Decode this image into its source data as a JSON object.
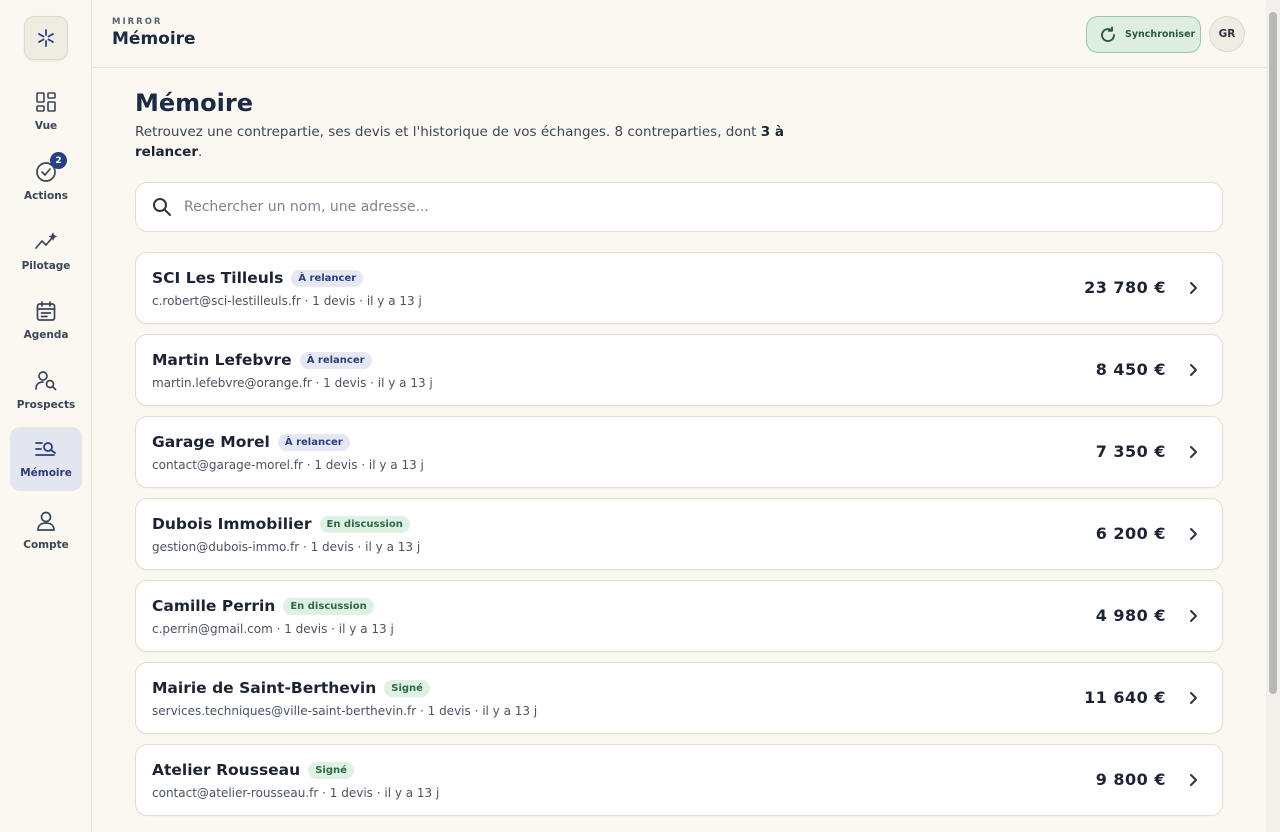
{
  "app": {
    "brand": "MIRROR",
    "title": "Mémoire"
  },
  "header": {
    "sync_label": "Synchroniser",
    "avatar_initials": "GR"
  },
  "sidebar": {
    "items": [
      {
        "label": "Vue",
        "icon": "dashboard-icon"
      },
      {
        "label": "Actions",
        "icon": "check-circle-icon",
        "badge": "2"
      },
      {
        "label": "Pilotage",
        "icon": "trend-sparkle-icon"
      },
      {
        "label": "Agenda",
        "icon": "calendar-icon"
      },
      {
        "label": "Prospects",
        "icon": "user-search-icon"
      },
      {
        "label": "Mémoire",
        "icon": "list-search-icon",
        "active": true
      },
      {
        "label": "Compte",
        "icon": "user-icon"
      }
    ]
  },
  "page": {
    "title": "Mémoire",
    "desc_prefix": "Retrouvez une contrepartie, ses devis et l'historique de vos échanges. 8 contreparties, dont ",
    "desc_bold": "3 à relancer",
    "desc_suffix": "."
  },
  "search": {
    "placeholder": "Rechercher un nom, une adresse..."
  },
  "counterparts": [
    {
      "name": "SCI Les Tilleuls",
      "status": "À relancer",
      "status_kind": "relancer",
      "meta": "c.robert@sci-lestilleuls.fr · 1 devis · il y a 13 j",
      "amount": "23 780 €"
    },
    {
      "name": "Martin Lefebvre",
      "status": "À relancer",
      "status_kind": "relancer",
      "meta": "martin.lefebvre@orange.fr · 1 devis · il y a 13 j",
      "amount": "8 450 €"
    },
    {
      "name": "Garage Morel",
      "status": "À relancer",
      "status_kind": "relancer",
      "meta": "contact@garage-morel.fr · 1 devis · il y a 13 j",
      "amount": "7 350 €"
    },
    {
      "name": "Dubois Immobilier",
      "status": "En discussion",
      "status_kind": "discussion",
      "meta": "gestion@dubois-immo.fr · 1 devis · il y a 13 j",
      "amount": "6 200 €"
    },
    {
      "name": "Camille Perrin",
      "status": "En discussion",
      "status_kind": "discussion",
      "meta": "c.perrin@gmail.com · 1 devis · il y a 13 j",
      "amount": "4 980 €"
    },
    {
      "name": "Mairie de Saint-Berthevin",
      "status": "Signé",
      "status_kind": "signe",
      "meta": "services.techniques@ville-saint-berthevin.fr · 1 devis · il y a 13 j",
      "amount": "11 640 €"
    },
    {
      "name": "Atelier Rousseau",
      "status": "Signé",
      "status_kind": "signe",
      "meta": "contact@atelier-rousseau.fr · 1 devis · il y a 13 j",
      "amount": "9 800 €"
    }
  ],
  "colors": {
    "accent": "#2b3f86",
    "sync_bg": "#dfeee3",
    "sync_border": "#9cc6a9",
    "background": "#faf8f1"
  }
}
